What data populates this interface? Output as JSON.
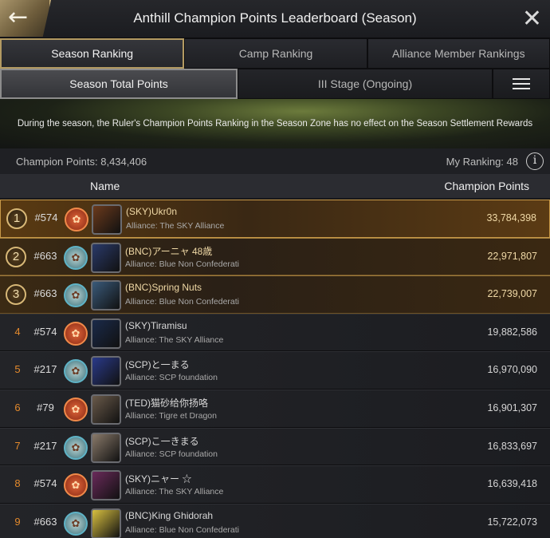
{
  "header": {
    "title": "Anthill Champion Points Leaderboard (Season)",
    "back_icon": "←",
    "close_icon": "✕"
  },
  "tabs": [
    {
      "label": "Season Ranking",
      "active": true
    },
    {
      "label": "Camp Ranking",
      "active": false
    },
    {
      "label": "Alliance Member Rankings",
      "active": false
    }
  ],
  "subtabs": [
    {
      "label": "Season Total Points",
      "active": true
    },
    {
      "label": "III Stage (Ongoing)",
      "active": false
    }
  ],
  "banner": {
    "text": "During the season, the Ruler's Champion Points Ranking in the Season Zone has no effect on the Season Settlement Rewards"
  },
  "stats": {
    "champion_points": "Champion Points: 8,434,406",
    "my_ranking": "My Ranking: 48",
    "info_icon": "i"
  },
  "columns": {
    "name": "Name",
    "points": "Champion Points"
  },
  "rows": [
    {
      "rank": "1",
      "server": "#574",
      "camp": "red",
      "player": "(SKY)Ukr0n",
      "alliance": "Alliance: The SKY Alliance",
      "points": "33,784,398",
      "avatar_color": "#6b3a1c"
    },
    {
      "rank": "2",
      "server": "#663",
      "camp": "blue",
      "player": "(BNC)アーニャ 48歳",
      "alliance": "Alliance: Blue Non Confederati",
      "points": "22,971,807",
      "avatar_color": "#2a3a6a"
    },
    {
      "rank": "3",
      "server": "#663",
      "camp": "blue",
      "player": "(BNC)Spring Nuts",
      "alliance": "Alliance: Blue Non Confederati",
      "points": "22,739,007",
      "avatar_color": "#3a5a7a"
    },
    {
      "rank": "4",
      "server": "#574",
      "camp": "red",
      "player": "(SKY)Tiramisu",
      "alliance": "Alliance: The SKY Alliance",
      "points": "19,882,586",
      "avatar_color": "#1a2a4a"
    },
    {
      "rank": "5",
      "server": "#217",
      "camp": "blue",
      "player": "(SCP)と一まる",
      "alliance": "Alliance: SCP foundation",
      "points": "16,970,090",
      "avatar_color": "#2a3a8a"
    },
    {
      "rank": "6",
      "server": "#79",
      "camp": "red",
      "player": "(TED)猫砂给你扬咯",
      "alliance": "Alliance: Tigre et Dragon",
      "points": "16,901,307",
      "avatar_color": "#6a5a4a"
    },
    {
      "rank": "7",
      "server": "#217",
      "camp": "blue",
      "player": "(SCP)こ一きまる",
      "alliance": "Alliance: SCP foundation",
      "points": "16,833,697",
      "avatar_color": "#8a7a6a"
    },
    {
      "rank": "8",
      "server": "#574",
      "camp": "red",
      "player": "(SKY)ニャー ☆",
      "alliance": "Alliance: The SKY Alliance",
      "points": "16,639,418",
      "avatar_color": "#6a2a5a"
    },
    {
      "rank": "9",
      "server": "#663",
      "camp": "blue",
      "player": "(BNC)King Ghidorah",
      "alliance": "Alliance: Blue Non Confederati",
      "points": "15,722,073",
      "avatar_color": "#d8c040"
    }
  ]
}
